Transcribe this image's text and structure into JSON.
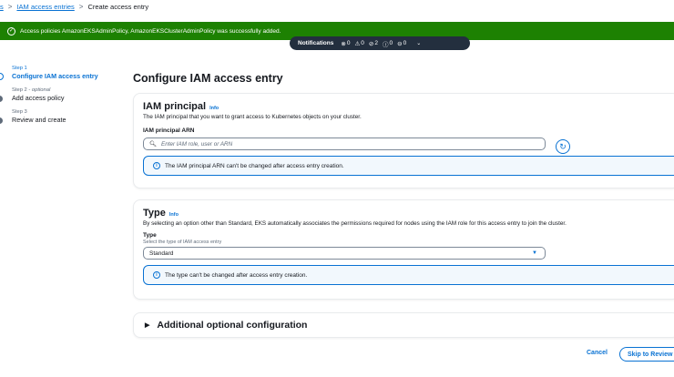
{
  "breadcrumb": {
    "items": [
      "s",
      "IAM access entries",
      "Create access entry"
    ],
    "separator": ">"
  },
  "flash": {
    "message": "Access policies AmazonEKSAdminPolicy, AmazonEKSClusterAdminPolicy was successfully added.",
    "color": "#1d8102"
  },
  "notifications": {
    "title": "Notifications",
    "error_count": "0",
    "warning_count": "0",
    "success_count": "2",
    "info_count": "0",
    "progress_count": "0"
  },
  "wizard": {
    "steps": [
      {
        "number": "Step 1",
        "name": "Configure IAM access entry",
        "optional": ""
      },
      {
        "number": "Step 2",
        "optional": "optional",
        "name": "Add access policy"
      },
      {
        "number": "Step 3",
        "name": "Review and create",
        "optional": ""
      }
    ]
  },
  "page_title": "Configure IAM access entry",
  "principal": {
    "heading": "IAM principal",
    "info": "Info",
    "description": "The IAM principal that you want to grant access to Kubernetes objects on your cluster.",
    "field_label": "IAM principal ARN",
    "placeholder": "Enter IAM role, user or ARN",
    "alert": "The IAM principal ARN can't be changed after access entry creation."
  },
  "type": {
    "heading": "Type",
    "info": "Info",
    "description": "By selecting an option other than Standard, EKS automatically associates the permissions required for nodes using the IAM role for this access entry to join the cluster.",
    "field_label": "Type",
    "field_hint": "Select the type of IAM access entry",
    "selected": "Standard",
    "alert": "The type can't be changed after access entry creation."
  },
  "additional": {
    "label": "Additional optional configuration"
  },
  "footer": {
    "cancel": "Cancel",
    "skip": "Skip to Review"
  },
  "colors": {
    "accent": "#0972d3",
    "success": "#1d8102",
    "dark": "#232f3e"
  }
}
